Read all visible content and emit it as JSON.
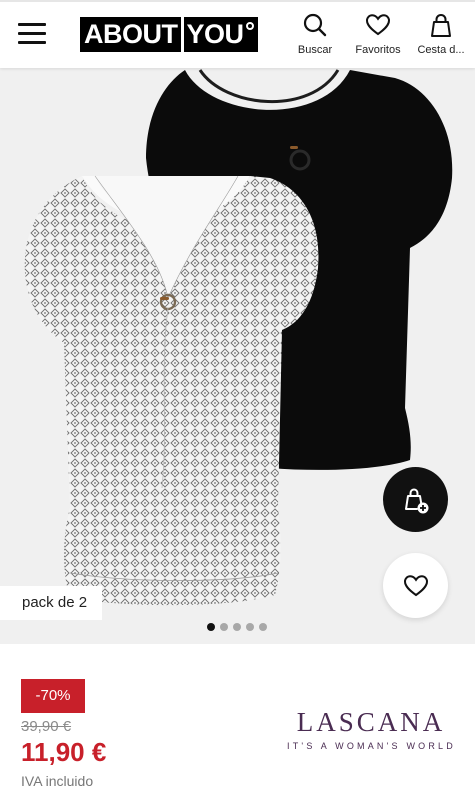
{
  "header": {
    "logo_text_left": "ABOUT",
    "logo_text_right": "YOU",
    "search_label": "Buscar",
    "favorites_label": "Favoritos",
    "cart_label": "Cesta d..."
  },
  "gallery": {
    "badge": "pack de 2",
    "image_count": 5,
    "active_index": 0,
    "product_colors": {
      "front_top": "white-grey geometric print",
      "back_top": "black"
    }
  },
  "actions": {
    "add_to_bag_icon": "bag-plus-icon",
    "favorite_icon": "heart-icon"
  },
  "price": {
    "discount": "-70%",
    "old_price": "39,90 €",
    "new_price": "11,90 €",
    "vat_note": "IVA incluido"
  },
  "brand": {
    "name": "LASCANA",
    "tagline": "IT'S A WOMAN'S WORLD"
  },
  "colors": {
    "sale_red": "#c8202a",
    "brand_purple": "#4a2c52",
    "gallery_bg": "#f0f0f0"
  }
}
